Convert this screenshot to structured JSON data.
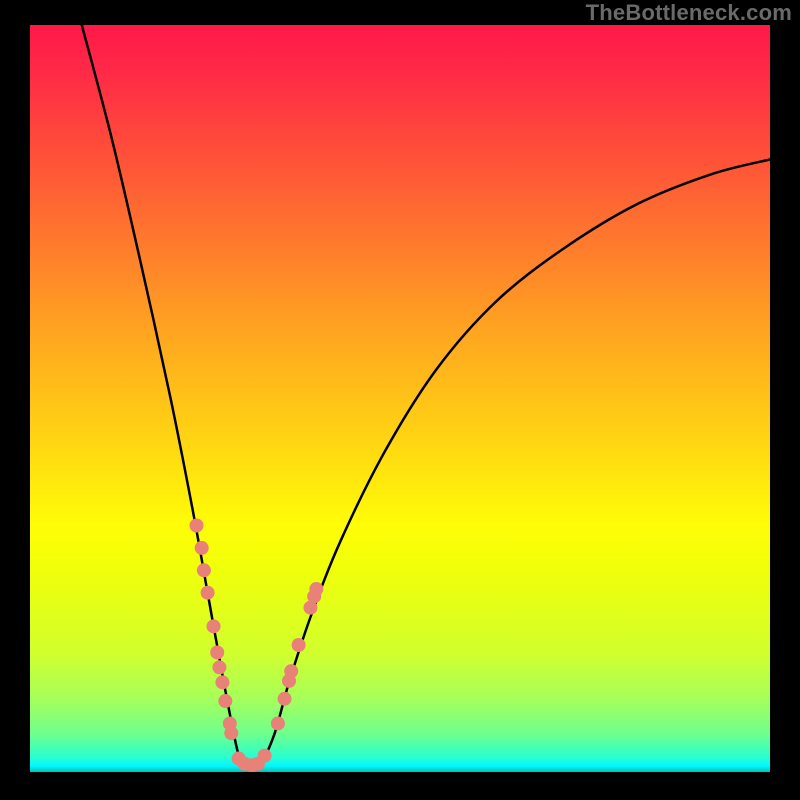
{
  "watermark": {
    "text": "TheBottleneck.com"
  },
  "chart_data": {
    "type": "line",
    "title": "",
    "xlabel": "",
    "ylabel": "",
    "xlim": [
      0,
      100
    ],
    "ylim": [
      0,
      100
    ],
    "gradient_colors": {
      "top": "#ff1948",
      "mid_upper": "#ff7d2c",
      "mid": "#fffd07",
      "lower": "#6dff8e",
      "bottom": "#00c2b0"
    },
    "series": [
      {
        "name": "bottleneck-curve",
        "description": "V-shaped curve with minimum near x≈28-31, rising steeply on left and gradually on right",
        "points": [
          {
            "x": 7,
            "y": 100
          },
          {
            "x": 11,
            "y": 85
          },
          {
            "x": 15,
            "y": 68
          },
          {
            "x": 19,
            "y": 50
          },
          {
            "x": 22,
            "y": 35
          },
          {
            "x": 24,
            "y": 24
          },
          {
            "x": 26,
            "y": 13
          },
          {
            "x": 28,
            "y": 3
          },
          {
            "x": 29,
            "y": 1
          },
          {
            "x": 31,
            "y": 1
          },
          {
            "x": 33,
            "y": 5
          },
          {
            "x": 35,
            "y": 12
          },
          {
            "x": 38,
            "y": 21
          },
          {
            "x": 42,
            "y": 31
          },
          {
            "x": 48,
            "y": 43
          },
          {
            "x": 55,
            "y": 54
          },
          {
            "x": 63,
            "y": 63
          },
          {
            "x": 72,
            "y": 70
          },
          {
            "x": 82,
            "y": 76
          },
          {
            "x": 92,
            "y": 80
          },
          {
            "x": 100,
            "y": 82
          }
        ]
      },
      {
        "name": "highlighted-markers",
        "description": "Salmon-colored dot markers clustered near bottom of V",
        "color": "#e88177",
        "points": [
          {
            "x": 22.5,
            "y": 33
          },
          {
            "x": 23.2,
            "y": 30
          },
          {
            "x": 23.5,
            "y": 27
          },
          {
            "x": 24.0,
            "y": 24
          },
          {
            "x": 24.8,
            "y": 19.5
          },
          {
            "x": 25.3,
            "y": 16
          },
          {
            "x": 25.6,
            "y": 14
          },
          {
            "x": 26.0,
            "y": 12
          },
          {
            "x": 26.4,
            "y": 9.5
          },
          {
            "x": 27.0,
            "y": 6.5
          },
          {
            "x": 27.2,
            "y": 5.2
          },
          {
            "x": 28.2,
            "y": 1.8
          },
          {
            "x": 29.0,
            "y": 1.1
          },
          {
            "x": 30.0,
            "y": 0.9
          },
          {
            "x": 30.8,
            "y": 1.1
          },
          {
            "x": 31.7,
            "y": 2.2
          },
          {
            "x": 33.5,
            "y": 6.5
          },
          {
            "x": 34.4,
            "y": 9.8
          },
          {
            "x": 35.0,
            "y": 12.2
          },
          {
            "x": 35.3,
            "y": 13.5
          },
          {
            "x": 36.3,
            "y": 17.0
          },
          {
            "x": 37.9,
            "y": 22.0
          },
          {
            "x": 38.4,
            "y": 23.5
          },
          {
            "x": 38.7,
            "y": 24.5
          }
        ]
      }
    ]
  }
}
